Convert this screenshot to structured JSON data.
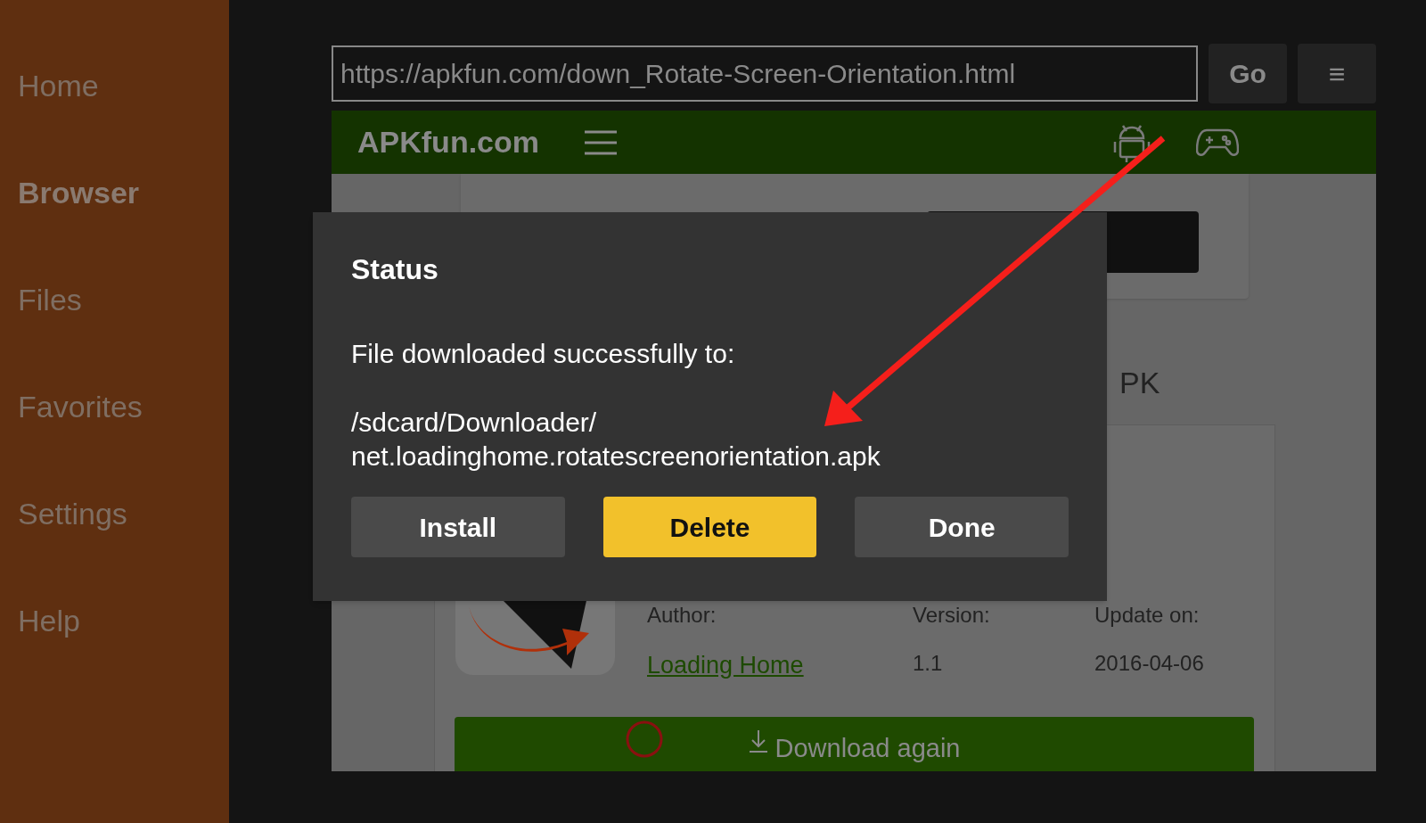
{
  "sidebar": {
    "items": [
      {
        "label": "Home",
        "selected": false
      },
      {
        "label": "Browser",
        "selected": true
      },
      {
        "label": "Files",
        "selected": false
      },
      {
        "label": "Favorites",
        "selected": false
      },
      {
        "label": "Settings",
        "selected": false
      },
      {
        "label": "Help",
        "selected": false
      }
    ]
  },
  "browser": {
    "url": "https://apkfun.com/down_Rotate-Screen-Orientation.html",
    "go_button": "Go",
    "menu_button": "≡"
  },
  "web_page": {
    "site_name": "APKfun.com",
    "partial_heading": "PK",
    "author_label": "Author:",
    "author": "Loading Home",
    "version_label": "Version:",
    "version": "1.1",
    "update_label": "Update on:",
    "update_date": "2016-04-06",
    "download_button": "Download again"
  },
  "dialog": {
    "title": "Status",
    "message": "File downloaded successfully to:",
    "path_lines": [
      "/sdcard/Downloader/",
      "net.loadinghome.rotatescreenorientation.apk"
    ],
    "buttons": [
      {
        "label": "Install",
        "selected": false
      },
      {
        "label": "Delete",
        "selected": true
      },
      {
        "label": "Done",
        "selected": false
      }
    ]
  }
}
